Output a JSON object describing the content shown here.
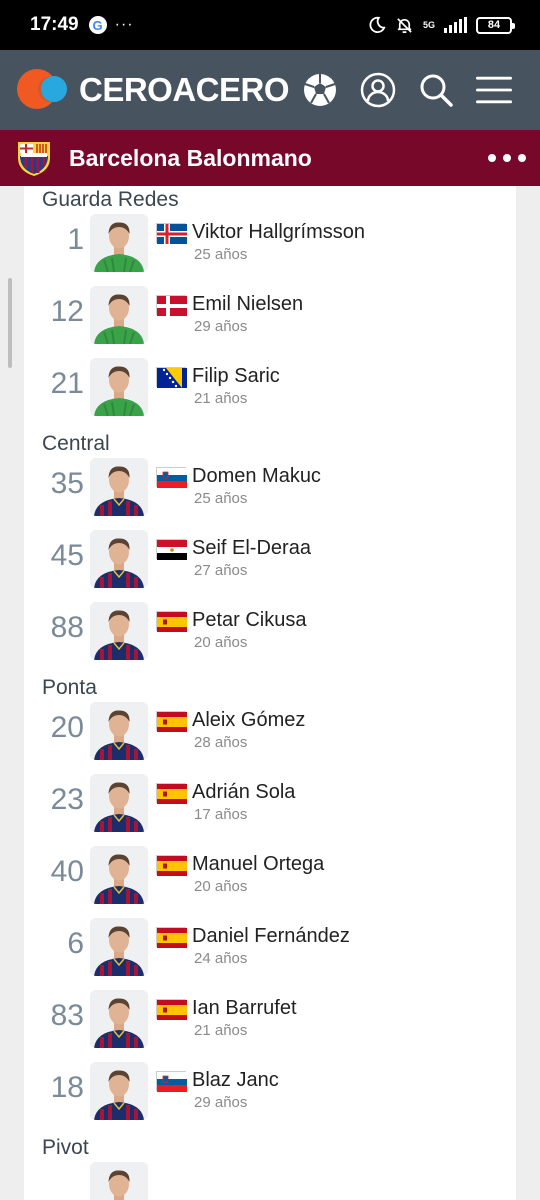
{
  "status": {
    "time": "17:49",
    "google": "G",
    "dots": "···",
    "network": "5G",
    "battery": "84"
  },
  "brand": {
    "name": "CEROACERO"
  },
  "team": {
    "name": "Barcelona Balonmano"
  },
  "colors": {
    "nav_bg": "#47535f",
    "team_bg": "#78082a",
    "keeper_kit": "#3aa34a",
    "field_kit": "#1c2d6b",
    "kit_stripe": "#a3163a"
  },
  "sections": [
    {
      "title": "Guarda Redes",
      "players": [
        {
          "number": "1",
          "name": "Viktor Hallgrímsson",
          "age": "25 años",
          "flag": "iceland",
          "kit": "keeper"
        },
        {
          "number": "12",
          "name": "Emil Nielsen",
          "age": "29 años",
          "flag": "denmark",
          "kit": "keeper"
        },
        {
          "number": "21",
          "name": "Filip Saric",
          "age": "21 años",
          "flag": "bosnia",
          "kit": "keeper"
        }
      ]
    },
    {
      "title": "Central",
      "players": [
        {
          "number": "35",
          "name": "Domen Makuc",
          "age": "25 años",
          "flag": "slovenia",
          "kit": "field"
        },
        {
          "number": "45",
          "name": "Seif El-Deraa",
          "age": "27 años",
          "flag": "egypt",
          "kit": "field"
        },
        {
          "number": "88",
          "name": "Petar Cikusa",
          "age": "20 años",
          "flag": "spain",
          "kit": "field"
        }
      ]
    },
    {
      "title": "Ponta",
      "players": [
        {
          "number": "20",
          "name": "Aleix Gómez",
          "age": "28 años",
          "flag": "spain",
          "kit": "field"
        },
        {
          "number": "23",
          "name": "Adrián Sola",
          "age": "17 años",
          "flag": "spain",
          "kit": "field"
        },
        {
          "number": "40",
          "name": "Manuel Ortega",
          "age": "20 años",
          "flag": "spain",
          "kit": "field"
        },
        {
          "number": "6",
          "name": "Daniel Fernández",
          "age": "24 años",
          "flag": "spain",
          "kit": "field"
        },
        {
          "number": "83",
          "name": "Ian Barrufet",
          "age": "21 años",
          "flag": "spain",
          "kit": "field"
        },
        {
          "number": "18",
          "name": "Blaz Janc",
          "age": "29 años",
          "flag": "slovenia",
          "kit": "field"
        }
      ]
    },
    {
      "title": "Pivot",
      "players": [
        {
          "number": "",
          "name": "",
          "age": "",
          "flag": "",
          "kit": "field"
        }
      ]
    }
  ]
}
